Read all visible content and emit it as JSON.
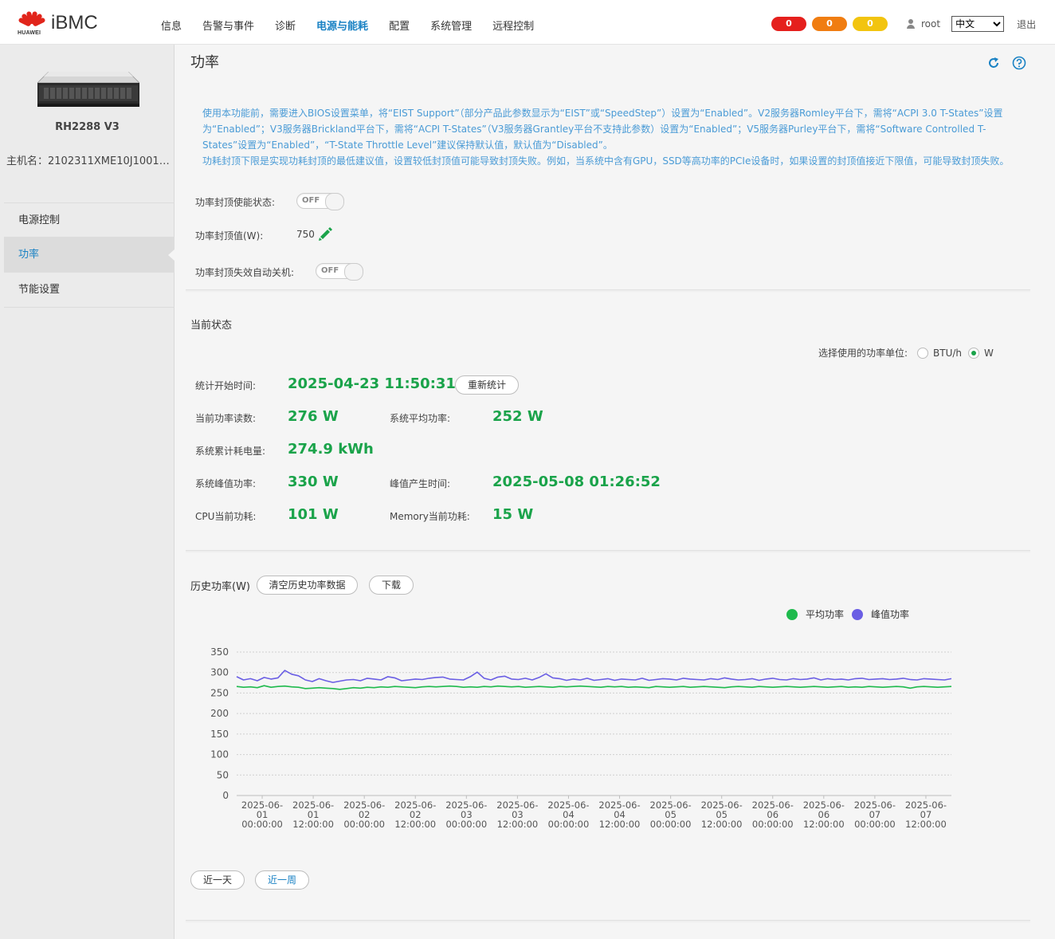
{
  "header": {
    "brand": "HUAWEI",
    "app_title": "iBMC",
    "nav": [
      "信息",
      "告警与事件",
      "诊断",
      "电源与能耗",
      "配置",
      "系统管理",
      "远程控制"
    ],
    "nav_active": 3,
    "alarms": [
      {
        "count": "0",
        "color": "#e5201d"
      },
      {
        "count": "0",
        "color": "#f07d11"
      },
      {
        "count": "0",
        "color": "#f2c40f"
      }
    ],
    "user": "root",
    "language": "中文",
    "logout": "退出"
  },
  "sidebar": {
    "server_model": "RH2288 V3",
    "host_name": "主机名：2102311XME10J10017...",
    "items": [
      "电源控制",
      "功率",
      "节能设置"
    ],
    "active": 1
  },
  "page": {
    "title": "功率",
    "notice_1": "使用本功能前，需要进入BIOS设置菜单，将“EIST Support”（部分产品此参数显示为“EIST”或“SpeedStep”）设置为“Enabled”。V2服务器Romley平台下，需将“ACPI 3.0 T-States”设置为“Enabled”；V3服务器Brickland平台下，需将“ACPI T-States”（V3服务器Grantley平台不支持此参数）设置为“Enabled”；V5服务器Purley平台下，需将“Software Controlled T-States”设置为“Enabled”，“T-State Throttle Level”建议保持默认值，默认值为“Disabled”。",
    "notice_2": "功耗封顶下限是实现功耗封顶的最低建议值，设置较低封顶值可能导致封顶失败。例如，当系统中含有GPU，SSD等高功率的PCIe设备时，如果设置的封顶值接近下限值，可能导致封顶失败。"
  },
  "capping": {
    "enable_label": "功率封顶使能状态:",
    "enable_state": "OFF",
    "value_label": "功率封顶值(W):",
    "value": "750",
    "shutdown_label": "功率封顶失效自动关机:",
    "shutdown_state": "OFF"
  },
  "status": {
    "title": "当前状态",
    "unit_label": "选择使用的功率单位:",
    "unit_options": [
      "BTU/h",
      "W"
    ],
    "unit_selected": "W",
    "start_time_label": "统计开始时间:",
    "start_time": "2025-04-23 11:50:31",
    "recount_btn": "重新统计",
    "current_label": "当前功率读数:",
    "current": "276 W",
    "avg_label": "系统平均功率:",
    "avg": "252 W",
    "energy_label": "系统累计耗电量:",
    "energy": "274.9 kWh",
    "peak_label": "系统峰值功率:",
    "peak": "330 W",
    "peak_time_label": "峰值产生时间:",
    "peak_time": "2025-05-08 01:26:52",
    "cpu_label": "CPU当前功耗:",
    "cpu": "101 W",
    "mem_label": "Memory当前功耗:",
    "mem": "15 W"
  },
  "history": {
    "title": "历史功率(W)",
    "clear_btn": "清空历史功率数据",
    "download_btn": "下载",
    "range_day": "近一天",
    "range_week": "近一周"
  },
  "chart_data": {
    "type": "line",
    "ylim": [
      0,
      350
    ],
    "yticks": [
      0,
      50,
      100,
      150,
      200,
      250,
      300,
      350
    ],
    "xlim": [
      0,
      14
    ],
    "xticks": [
      [
        "2025-06-",
        "01",
        "00:00:00"
      ],
      [
        "2025-06-",
        "01",
        "12:00:00"
      ],
      [
        "2025-06-",
        "02",
        "00:00:00"
      ],
      [
        "2025-06-",
        "02",
        "12:00:00"
      ],
      [
        "2025-06-",
        "03",
        "00:00:00"
      ],
      [
        "2025-06-",
        "03",
        "12:00:00"
      ],
      [
        "2025-06-",
        "04",
        "00:00:00"
      ],
      [
        "2025-06-",
        "04",
        "12:00:00"
      ],
      [
        "2025-06-",
        "05",
        "00:00:00"
      ],
      [
        "2025-06-",
        "05",
        "12:00:00"
      ],
      [
        "2025-06-",
        "06",
        "00:00:00"
      ],
      [
        "2025-06-",
        "06",
        "12:00:00"
      ],
      [
        "2025-06-",
        "07",
        "00:00:00"
      ],
      [
        "2025-06-",
        "07",
        "12:00:00"
      ]
    ],
    "grid": true,
    "legend": "top-right",
    "series": [
      {
        "name": "平均功率",
        "color": "#1fba4d",
        "values": [
          266,
          264,
          265,
          263,
          268,
          264,
          266,
          267,
          265,
          264,
          261,
          262,
          263,
          262,
          261,
          259,
          261,
          263,
          262,
          264,
          263,
          265,
          264,
          266,
          265,
          264,
          263,
          265,
          266,
          265,
          266,
          267,
          266,
          264,
          265,
          264,
          266,
          265,
          267,
          266,
          265,
          266,
          264,
          265,
          266,
          265,
          264,
          266,
          265,
          266,
          267,
          266,
          265,
          264,
          266,
          265,
          266,
          264,
          265,
          264,
          263,
          266,
          265,
          264,
          265,
          266,
          264,
          265,
          266,
          265,
          264,
          263,
          265,
          266,
          265,
          264,
          266,
          265,
          264,
          265,
          266,
          265,
          264,
          265,
          266,
          265,
          264,
          265,
          266,
          264,
          265,
          264,
          266,
          265,
          264,
          265,
          266,
          265,
          262,
          265,
          266,
          265,
          264,
          265,
          266
        ]
      },
      {
        "name": "峰值功率",
        "color": "#6a5ee4",
        "values": [
          290,
          282,
          285,
          280,
          288,
          284,
          287,
          305,
          296,
          292,
          282,
          278,
          285,
          280,
          276,
          279,
          282,
          283,
          280,
          286,
          284,
          282,
          290,
          287,
          280,
          282,
          284,
          283,
          286,
          288,
          289,
          284,
          283,
          282,
          290,
          301,
          286,
          282,
          289,
          291,
          284,
          283,
          286,
          282,
          288,
          297,
          287,
          285,
          281,
          284,
          282,
          286,
          281,
          283,
          285,
          281,
          284,
          283,
          282,
          286,
          281,
          283,
          285,
          284,
          282,
          286,
          284,
          283,
          282,
          285,
          283,
          287,
          284,
          282,
          283,
          285,
          281,
          284,
          286,
          283,
          282,
          285,
          283,
          284,
          287,
          282,
          285,
          283,
          284,
          282,
          285,
          286,
          283,
          284,
          285,
          283,
          284,
          286,
          283,
          282,
          285,
          284,
          283,
          282,
          285
        ]
      }
    ]
  }
}
